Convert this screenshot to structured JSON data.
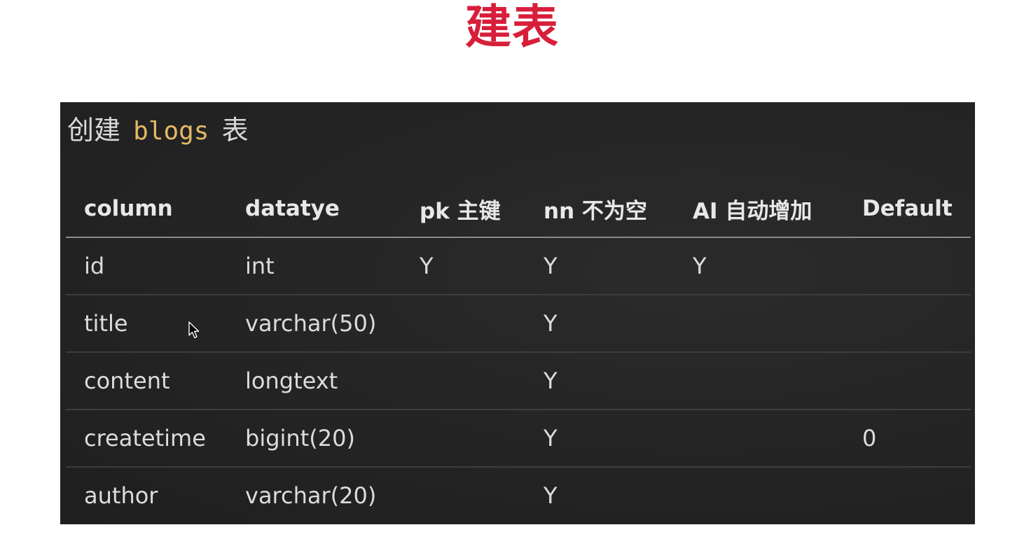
{
  "title": "建表",
  "panel": {
    "heading_prefix": "创建",
    "heading_code": "blogs",
    "heading_suffix": "表"
  },
  "table": {
    "headers": [
      "column",
      "datatye",
      "pk 主键",
      "nn 不为空",
      "AI 自动增加",
      "Default"
    ],
    "rows": [
      [
        "id",
        "int",
        "Y",
        "Y",
        "Y",
        ""
      ],
      [
        "title",
        "varchar(50)",
        "",
        "Y",
        "",
        ""
      ],
      [
        "content",
        "longtext",
        "",
        "Y",
        "",
        ""
      ],
      [
        "createtime",
        "bigint(20)",
        "",
        "Y",
        "",
        "0"
      ],
      [
        "author",
        "varchar(20)",
        "",
        "Y",
        "",
        ""
      ]
    ]
  },
  "colors": {
    "title": "#d81e3a",
    "panel_bg": "#242424",
    "code": "#e4b867"
  },
  "icons": {
    "cursor": "mouse-pointer-icon"
  }
}
